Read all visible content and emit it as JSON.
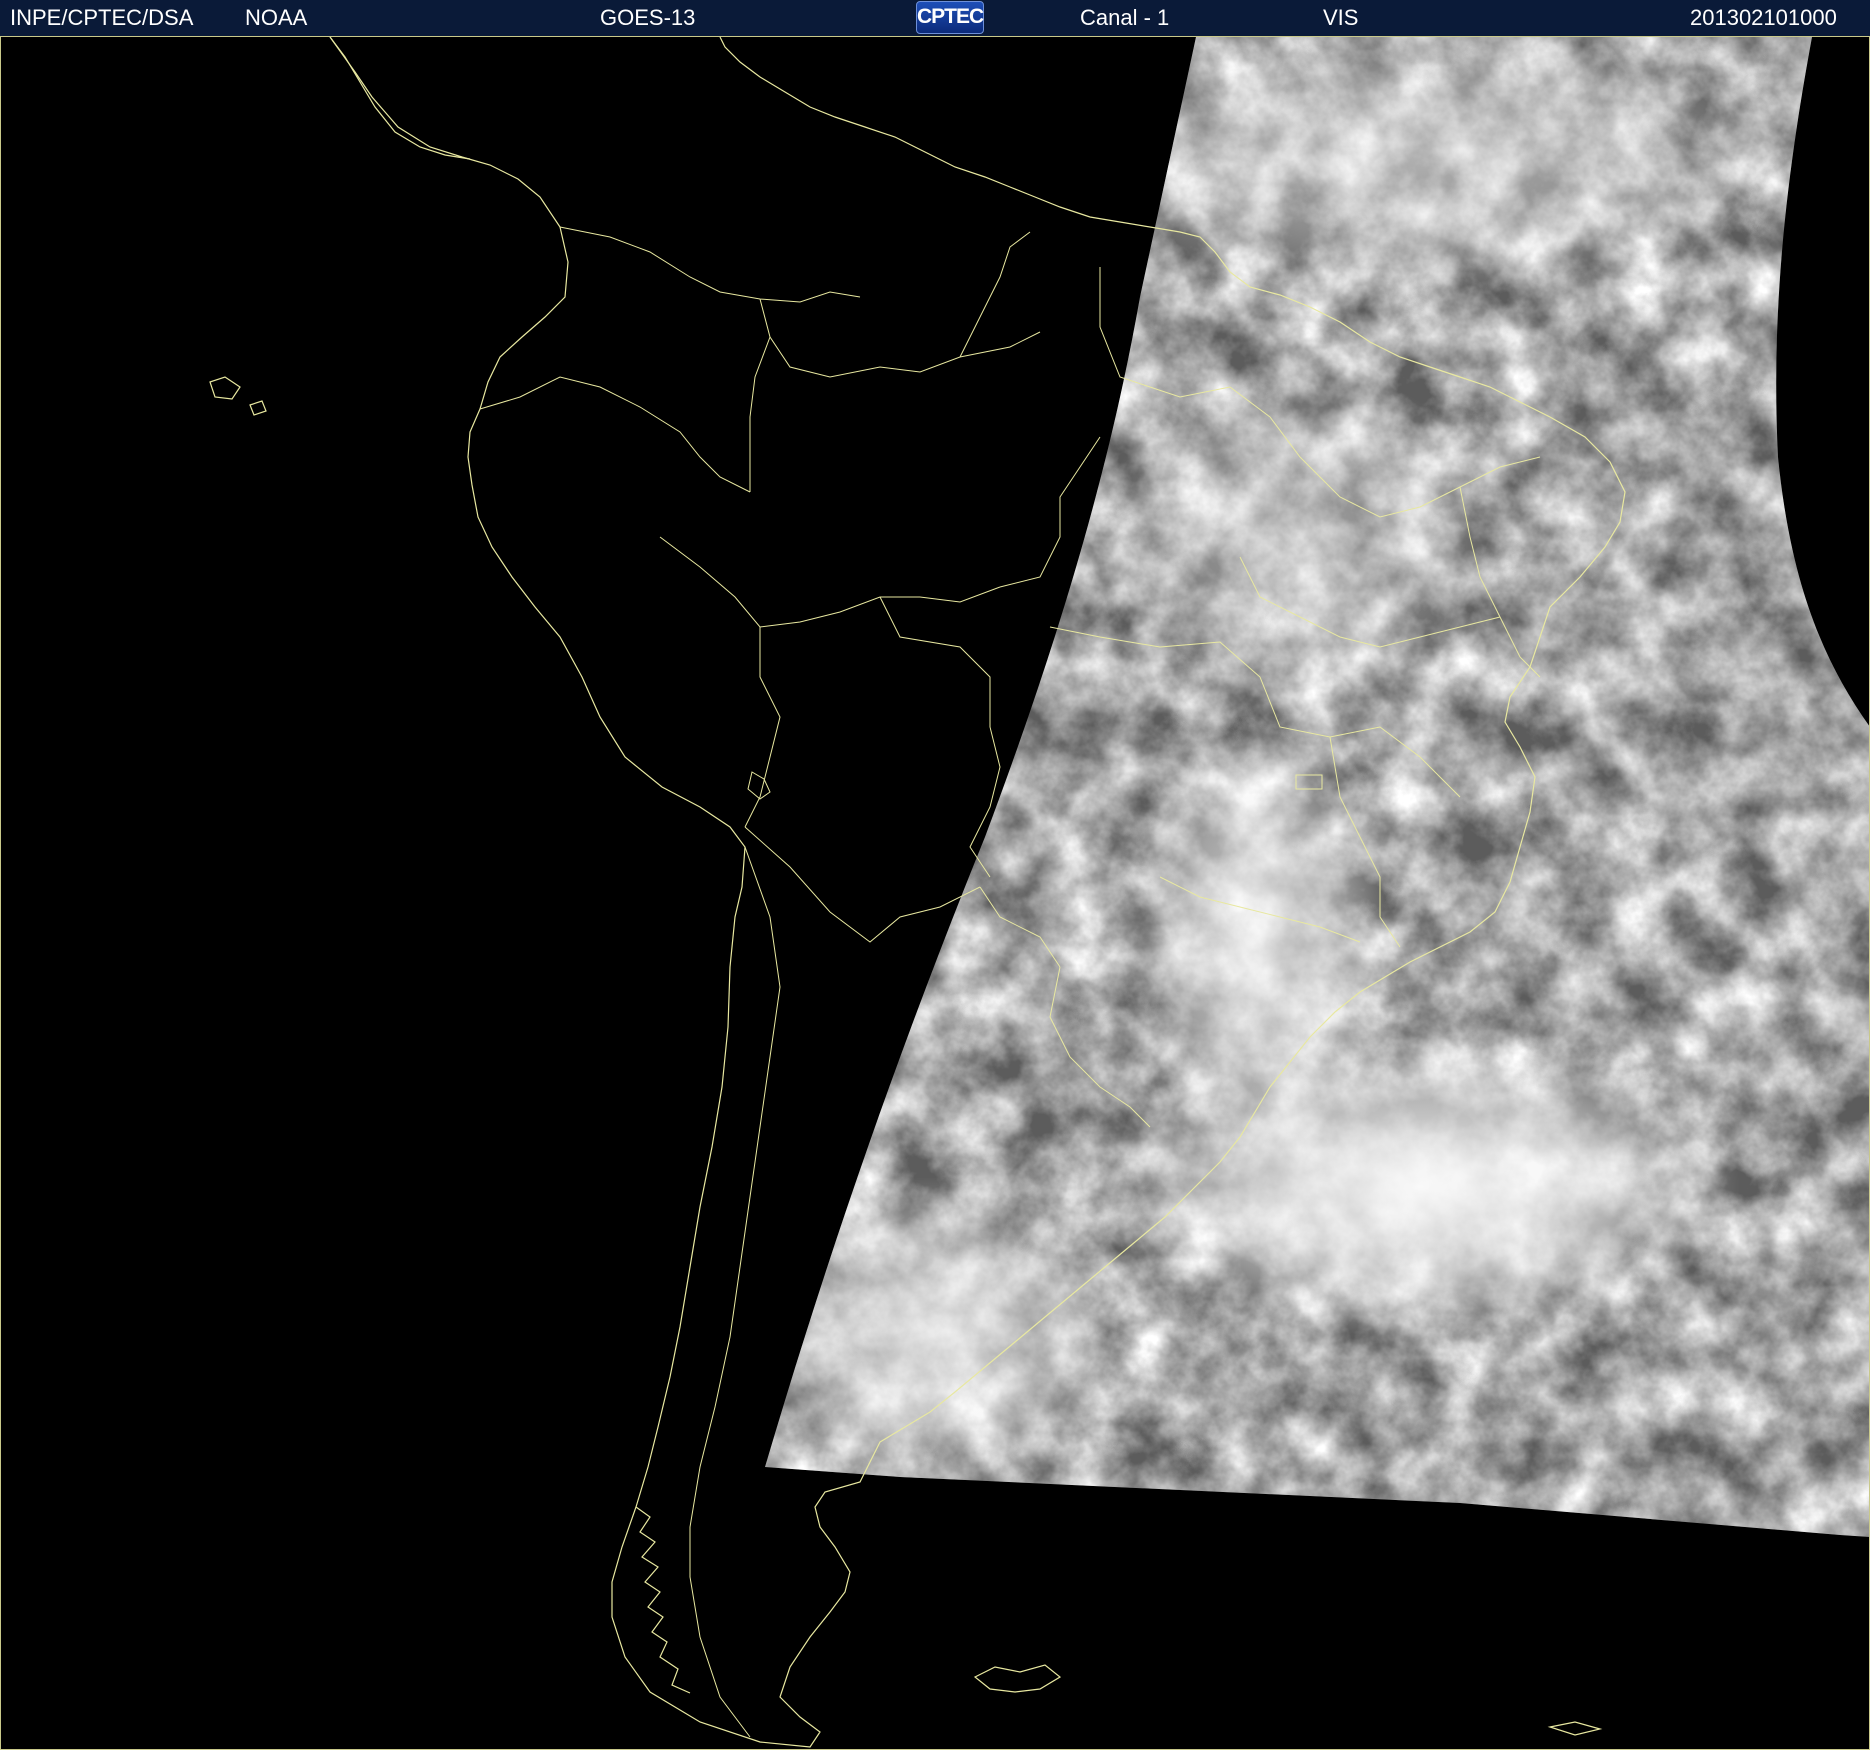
{
  "header": {
    "institution": "INPE/CPTEC/DSA",
    "agency": "NOAA",
    "satellite": "GOES-13",
    "logo_text": "CPTEC",
    "channel": "Canal - 1",
    "band": "VIS",
    "timestamp": "201302101000"
  },
  "map": {
    "coastline_color": "#e8e8a0",
    "background_color": "#000000",
    "imagery": "visible-satellite-cloud-cover"
  }
}
